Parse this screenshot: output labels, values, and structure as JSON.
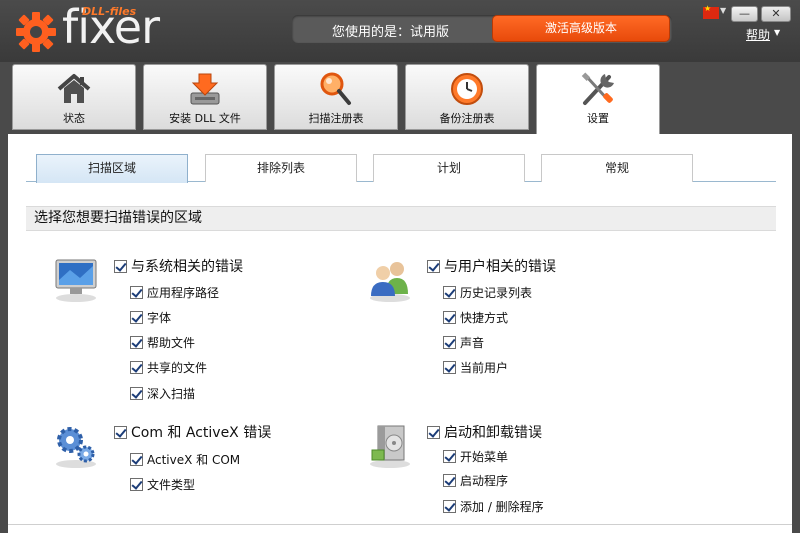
{
  "header": {
    "logo_word": "fixer",
    "logo_sub": "DLL-files",
    "license_text": "您使用的是：试用版",
    "activate_label": "激活高级版本",
    "help_label": "帮助",
    "minimize_glyph": "—",
    "maximize_glyph": "□",
    "close_glyph": "✕"
  },
  "main_tabs": [
    {
      "label": "状态",
      "icon": "home-icon"
    },
    {
      "label": "安装 DLL 文件",
      "icon": "install-download-icon"
    },
    {
      "label": "扫描注册表",
      "icon": "magnifier-icon"
    },
    {
      "label": "备份注册表",
      "icon": "backup-clock-icon"
    },
    {
      "label": "设置",
      "icon": "tools-icon"
    }
  ],
  "sub_tabs": [
    "扫描区域",
    "排除列表",
    "计划",
    "常规"
  ],
  "section_title": "选择您想要扫描错误的区域",
  "groups": {
    "system": {
      "title": "与系统相关的错误",
      "items": [
        "应用程序路径",
        "字体",
        "帮助文件",
        "共享的文件",
        "深入扫描"
      ]
    },
    "user": {
      "title": "与用户相关的错误",
      "items": [
        "历史记录列表",
        "快捷方式",
        "声音",
        "当前用户"
      ]
    },
    "com": {
      "title": "Com 和 ActiveX 错误",
      "items": [
        "ActiveX 和 COM",
        "文件类型"
      ]
    },
    "startup": {
      "title": "启动和卸载错误",
      "items": [
        "开始菜单",
        "启动程序",
        "添加 / 删除程序"
      ]
    }
  },
  "colors": {
    "accent": "#ff5f1f",
    "header_bg": "#444444",
    "subtab_active": "#d5e6f5"
  }
}
